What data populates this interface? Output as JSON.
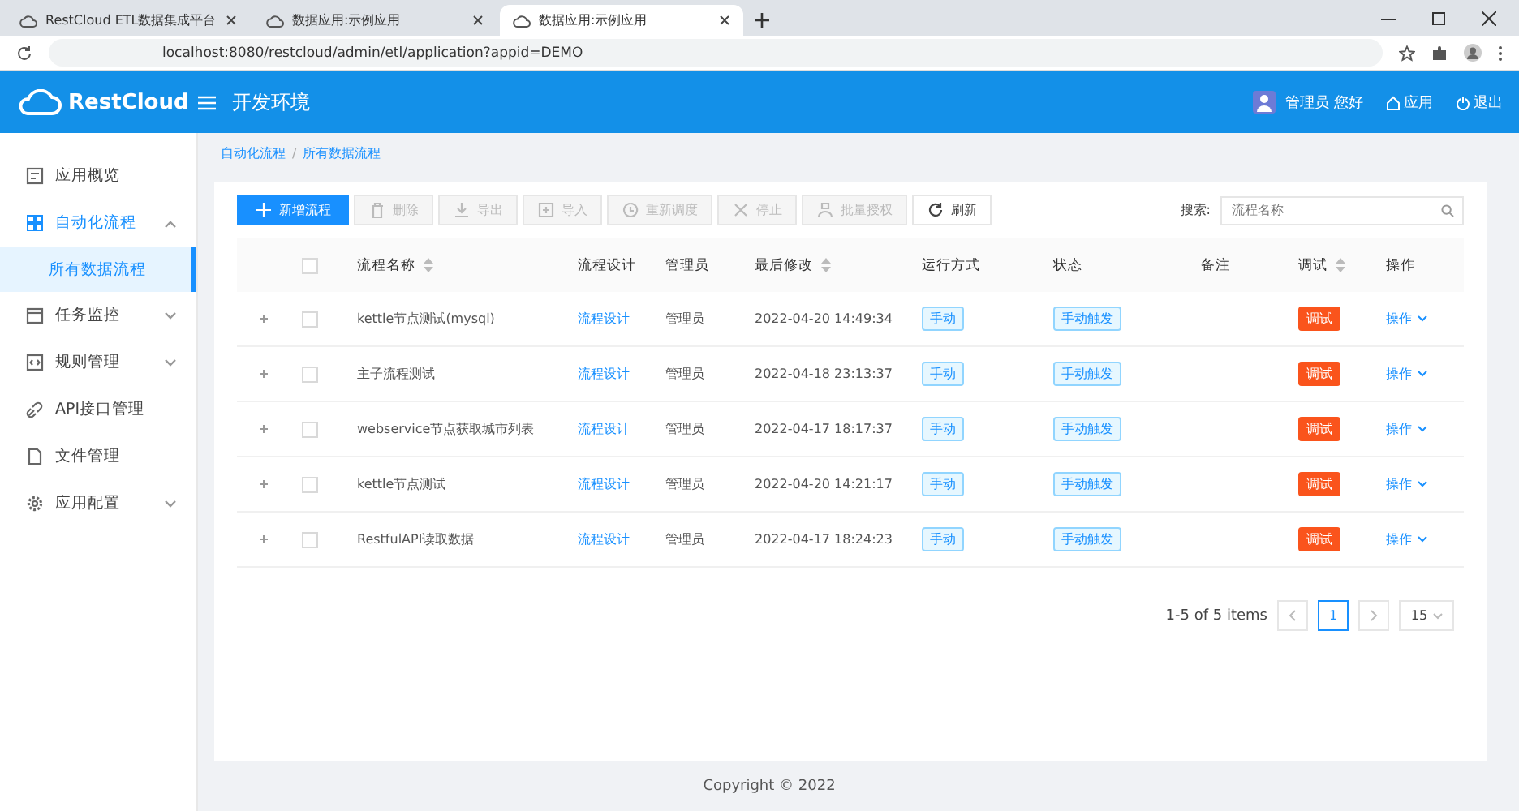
{
  "browser": {
    "tabs": [
      {
        "title": "RestCloud ETL数据集成平台",
        "selected": false
      },
      {
        "title": "数据应用:示例应用",
        "selected": false
      },
      {
        "title": "数据应用:示例应用",
        "selected": true
      }
    ],
    "address": "localhost:8080/restcloud/admin/etl/application?appid=DEMO"
  },
  "header": {
    "logo": "RestCloud",
    "environment": "开发环境",
    "user": "管理员 您好",
    "links": [
      "应用",
      "退出"
    ]
  },
  "sidebar": {
    "items": [
      {
        "label": "应用概览",
        "expanded": false,
        "has_children": false
      },
      {
        "label": "自动化流程",
        "expanded": true,
        "has_children": true,
        "children": [
          {
            "label": "所有数据流程",
            "selected": true
          }
        ]
      },
      {
        "label": "任务监控",
        "expanded": false,
        "has_children": true
      },
      {
        "label": "规则管理",
        "expanded": false,
        "has_children": true
      },
      {
        "label": "API接口管理",
        "expanded": false,
        "has_children": false
      },
      {
        "label": "文件管理",
        "expanded": false,
        "has_children": false
      },
      {
        "label": "应用配置",
        "expanded": false,
        "has_children": true
      }
    ]
  },
  "breadcrumb": {
    "items": [
      "自动化流程",
      "所有数据流程"
    ],
    "separator": "/"
  },
  "toolbar": {
    "buttons": [
      {
        "label": "新增流程",
        "kind": "primary",
        "disabled": false
      },
      {
        "label": "删除",
        "kind": "default",
        "disabled": true
      },
      {
        "label": "导出",
        "kind": "default",
        "disabled": true
      },
      {
        "label": "导入",
        "kind": "default",
        "disabled": true
      },
      {
        "label": "重新调度",
        "kind": "default",
        "disabled": true
      },
      {
        "label": "停止",
        "kind": "default",
        "disabled": true
      },
      {
        "label": "批量授权",
        "kind": "default",
        "disabled": true
      },
      {
        "label": "刷新",
        "kind": "default",
        "disabled": false
      }
    ],
    "search_label": "搜索:",
    "search_placeholder": "流程名称"
  },
  "table": {
    "select_all_checked": false,
    "columns": [
      {
        "label": "流程名称",
        "sortable": true
      },
      {
        "label": "流程设计",
        "sortable": false
      },
      {
        "label": "管理员",
        "sortable": false
      },
      {
        "label": "最后修改",
        "sortable": true
      },
      {
        "label": "运行方式",
        "sortable": false
      },
      {
        "label": "状态",
        "sortable": false
      },
      {
        "label": "备注",
        "sortable": false
      },
      {
        "label": "调试",
        "sortable": true
      },
      {
        "label": "操作",
        "sortable": false
      }
    ],
    "rows": [
      {
        "checked": false,
        "name": "kettle节点测试(mysql)",
        "design": "流程设计",
        "admin": "管理员",
        "modified": "2022-04-20 14:49:34",
        "run_mode": "手动",
        "status": "手动触发",
        "debug": "调试",
        "action": "操作"
      },
      {
        "checked": false,
        "name": "主子流程测试",
        "design": "流程设计",
        "admin": "管理员",
        "modified": "2022-04-18 23:13:37",
        "run_mode": "手动",
        "status": "手动触发",
        "debug": "调试",
        "action": "操作"
      },
      {
        "checked": false,
        "name": "webservice节点获取城市列表",
        "design": "流程设计",
        "admin": "管理员",
        "modified": "2022-04-17 18:17:37",
        "run_mode": "手动",
        "status": "手动触发",
        "debug": "调试",
        "action": "操作"
      },
      {
        "checked": false,
        "name": "kettle节点测试",
        "design": "流程设计",
        "admin": "管理员",
        "modified": "2022-04-20 14:21:17",
        "run_mode": "手动",
        "status": "手动触发",
        "debug": "调试",
        "action": "操作"
      },
      {
        "checked": false,
        "name": "RestfulAPI读取数据",
        "design": "流程设计",
        "admin": "管理员",
        "modified": "2022-04-17 18:24:23",
        "run_mode": "手动",
        "status": "手动触发",
        "debug": "调试",
        "action": "操作"
      }
    ]
  },
  "pagination": {
    "summary": "1-5 of 5 items",
    "pages": [
      {
        "label": "1",
        "selected": true
      }
    ],
    "page_size": "15"
  },
  "footer": {
    "copyright": "Copyright © 2022"
  }
}
